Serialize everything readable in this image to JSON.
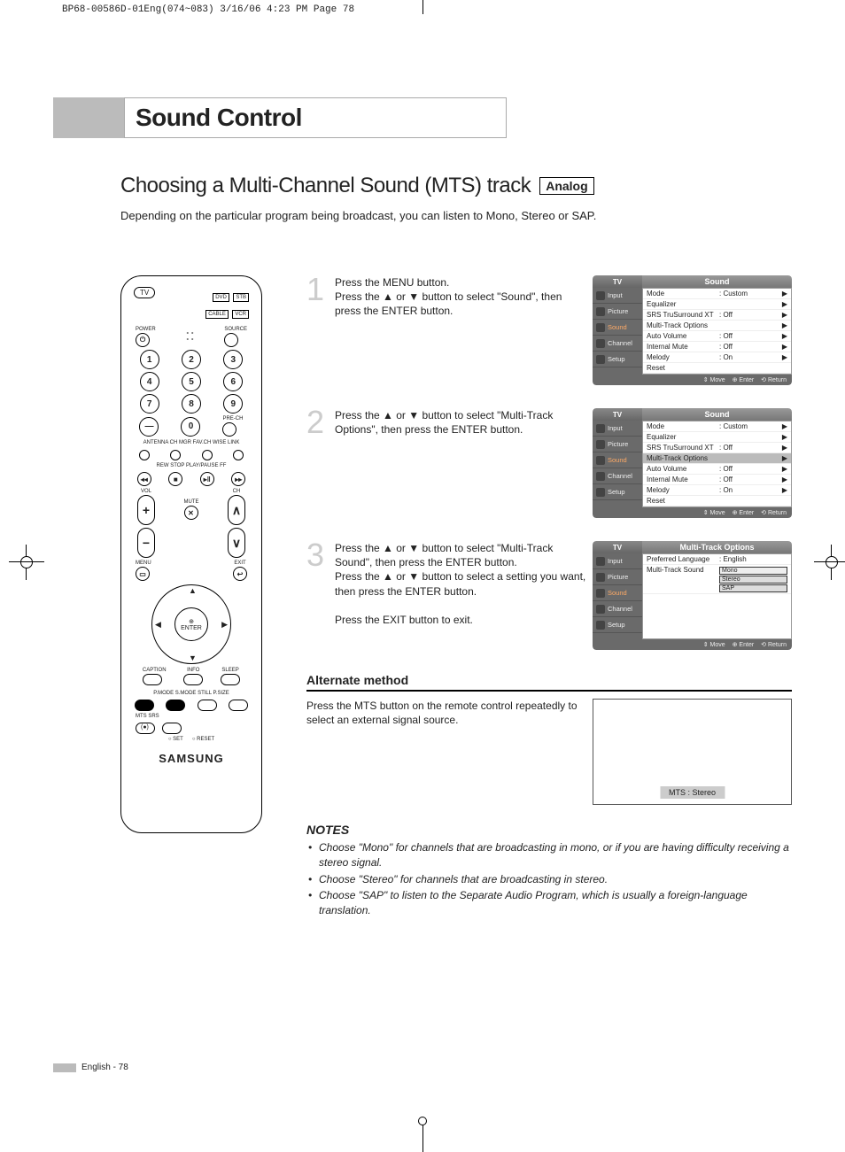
{
  "crop_header": "BP68-00586D-01Eng(074~083)  3/16/06  4:23 PM  Page 78",
  "section_title": "Sound Control",
  "subtitle": "Choosing a Multi-Channel Sound (MTS) track",
  "badge": "Analog",
  "intro": "Depending on the particular program being broadcast, you can listen to Mono, Stereo or SAP.",
  "remote": {
    "top_left": "TV",
    "boxes": [
      "DVD",
      "STB",
      "CABLE",
      "VCR"
    ],
    "power": "POWER",
    "source": "SOURCE",
    "nums": [
      "1",
      "2",
      "3",
      "4",
      "5",
      "6",
      "7",
      "8",
      "9",
      "0"
    ],
    "dash": "—",
    "prech": "PRE-CH",
    "row_labels": "ANTENNA  CH MGR  FAV.CH  WISE LINK",
    "transport": "REW    STOP   PLAY/PAUSE   FF",
    "vol": "VOL",
    "ch": "CH",
    "mute": "MUTE",
    "menu": "MENU",
    "exit": "EXIT",
    "enter": "ENTER",
    "caption": "CAPTION",
    "info": "INFO",
    "sleep": "SLEEP",
    "bottom_row1": "P.MODE  S.MODE  STILL   P.SIZE",
    "bottom_row2": "MTS     SRS",
    "set": "SET",
    "reset": "RESET",
    "brand": "SAMSUNG"
  },
  "steps": [
    {
      "num": "1",
      "text": "Press the MENU button.\nPress the ▲ or ▼ button to select \"Sound\", then press the ENTER button.",
      "osd": {
        "title": "Sound",
        "highlight": null,
        "rows": [
          {
            "lbl": "Mode",
            "val": ": Custom",
            "arr": "▶"
          },
          {
            "lbl": "Equalizer",
            "val": "",
            "arr": "▶"
          },
          {
            "lbl": "SRS TruSurround XT",
            "val": ": Off",
            "arr": "▶"
          },
          {
            "lbl": "Multi-Track Options",
            "val": "",
            "arr": "▶"
          },
          {
            "lbl": "Auto Volume",
            "val": ": Off",
            "arr": "▶"
          },
          {
            "lbl": "Internal Mute",
            "val": ": Off",
            "arr": "▶"
          },
          {
            "lbl": "Melody",
            "val": ": On",
            "arr": "▶"
          },
          {
            "lbl": "Reset",
            "val": "",
            "arr": ""
          }
        ]
      }
    },
    {
      "num": "2",
      "text": "Press the ▲ or ▼ button to select \"Multi-Track Options\", then press the ENTER button.",
      "osd": {
        "title": "Sound",
        "highlight": 3,
        "rows": [
          {
            "lbl": "Mode",
            "val": ": Custom",
            "arr": "▶"
          },
          {
            "lbl": "Equalizer",
            "val": "",
            "arr": "▶"
          },
          {
            "lbl": "SRS TruSurround XT",
            "val": ": Off",
            "arr": "▶"
          },
          {
            "lbl": "Multi-Track Options",
            "val": "",
            "arr": "▶"
          },
          {
            "lbl": "Auto Volume",
            "val": ": Off",
            "arr": "▶"
          },
          {
            "lbl": "Internal Mute",
            "val": ": Off",
            "arr": "▶"
          },
          {
            "lbl": "Melody",
            "val": ": On",
            "arr": "▶"
          },
          {
            "lbl": "Reset",
            "val": "",
            "arr": ""
          }
        ]
      }
    },
    {
      "num": "3",
      "text": "Press the ▲ or ▼ button to select \"Multi-Track Sound\", then press the ENTER button.\nPress the ▲ or ▼ button to select a setting you want, then press the ENTER button.\n\nPress the EXIT button to exit.",
      "osd": {
        "title": "Multi-Track Options",
        "rows_mt": [
          {
            "lbl": "Preferred Language",
            "val": ": English"
          },
          {
            "lbl": "Multi-Track Sound",
            "opts": [
              "Mono",
              "Stereo",
              "SAP"
            ]
          }
        ]
      }
    }
  ],
  "osd_nav": [
    "Input",
    "Picture",
    "Sound",
    "Channel",
    "Setup"
  ],
  "osd_tv": "TV",
  "osd_footer": {
    "move": "Move",
    "enter": "Enter",
    "return": "Return"
  },
  "alternate": {
    "header": "Alternate method",
    "text": "Press the MTS button on the remote control repeatedly to select an external signal source.",
    "box_label": "MTS : Stereo"
  },
  "notes": {
    "header": "NOTES",
    "items": [
      "Choose \"Mono\" for channels that are broadcasting in mono, or if you are having difficulty receiving a stereo signal.",
      "Choose \"Stereo\" for channels that are broadcasting in stereo.",
      "Choose \"SAP\" to listen to the Separate Audio Program, which is usually a foreign-language translation."
    ]
  },
  "footer": "English - 78"
}
